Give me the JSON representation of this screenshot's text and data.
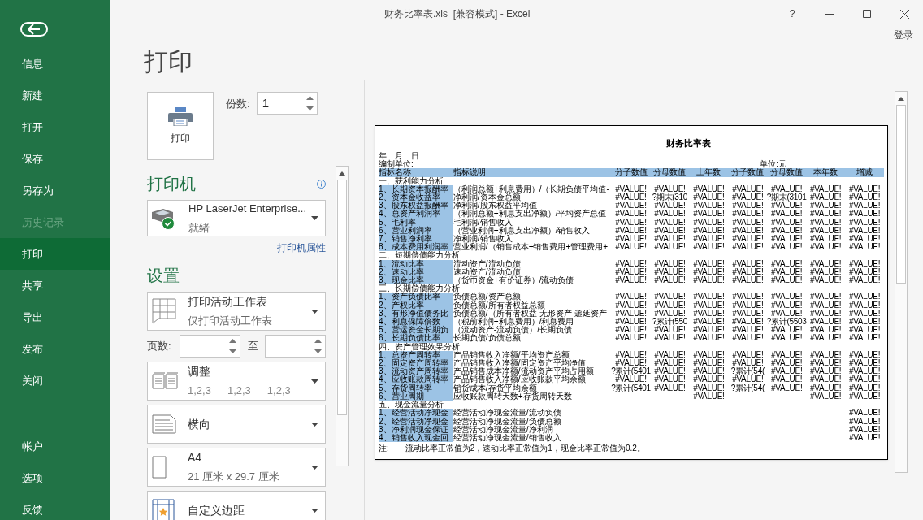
{
  "window": {
    "title": "财务比率表.xls  [兼容模式] - Excel",
    "help": "?",
    "sign_in": "登录"
  },
  "nav": {
    "items": [
      {
        "label": "信息",
        "selected": false,
        "disabled": false
      },
      {
        "label": "新建",
        "selected": false,
        "disabled": false
      },
      {
        "label": "打开",
        "selected": false,
        "disabled": false
      },
      {
        "label": "保存",
        "selected": false,
        "disabled": false
      },
      {
        "label": "另存为",
        "selected": false,
        "disabled": false
      },
      {
        "label": "历史记录",
        "selected": false,
        "disabled": true
      },
      {
        "label": "打印",
        "selected": true,
        "disabled": false
      },
      {
        "label": "共享",
        "selected": false,
        "disabled": false
      },
      {
        "label": "导出",
        "selected": false,
        "disabled": false
      },
      {
        "label": "发布",
        "selected": false,
        "disabled": false
      },
      {
        "label": "关闭",
        "selected": false,
        "disabled": false
      }
    ],
    "footer_items": [
      {
        "label": "帐户",
        "selected": false,
        "disabled": false
      },
      {
        "label": "选项",
        "selected": false,
        "disabled": false
      },
      {
        "label": "反馈",
        "selected": false,
        "disabled": false
      }
    ]
  },
  "page_title": "打印",
  "print_button": {
    "label": "打印"
  },
  "copies": {
    "label": "份数:",
    "value": "1"
  },
  "printer": {
    "heading": "打印机",
    "name": "HP LaserJet Enterprise...",
    "status": "就绪",
    "properties_link": "打印机属性"
  },
  "settings": {
    "heading": "设置",
    "options": [
      {
        "kind": "sheets",
        "title": "打印活动工作表",
        "subtitle": "仅打印活动工作表"
      },
      {
        "kind": "pages",
        "label": "页数:",
        "to": "至"
      },
      {
        "kind": "collate",
        "title": "调整",
        "sequences": [
          "1,2,3",
          "1,2,3",
          "1,2,3"
        ]
      },
      {
        "kind": "orientation",
        "title": "横向"
      },
      {
        "kind": "paper",
        "title": "A4",
        "subtitle": "21 厘米 x 29.7 厘米"
      },
      {
        "kind": "margins",
        "title": "自定义边距"
      }
    ]
  },
  "preview": {
    "title": "财务比率表",
    "date": "年　月　日",
    "unit_label": "编制单位:",
    "unit": "单位:元",
    "columns": [
      "指标名称",
      "指标说明",
      "分子数值",
      "分母数值",
      "上年数",
      "分子数值",
      "分母数值",
      "本年数",
      "增减"
    ],
    "sections": [
      {
        "heading": "一、获利能力分析",
        "rows": [
          {
            "name": "1、长期资本报酬率",
            "formula": "（利润总额+利息费用）/（长期负债平均值-",
            "values": {
              "column_3": "#VALUE!",
              "column_4": "#VALUE!",
              "column_5": "#VALUE!",
              "column_6": "#VALUE!",
              "column_7": "#VALUE!",
              "column_8": "#VALUE!",
              "column_9": "#VALUE!"
            }
          },
          {
            "name": "2、资本金收益率",
            "formula": "净利润/资本金总额",
            "values": {
              "column_3": "#VALUE!",
              "column_4": "?期末(310",
              "column_5": "#VALUE!",
              "column_6": "#VALUE!",
              "column_7": "?期末(3101",
              "column_8": "#VALUE!",
              "column_9": "#VALUE!"
            }
          },
          {
            "name": "3、股东权益报酬率",
            "formula": "净利润/股东权益平均值",
            "values": {
              "column_3": "#VALUE!",
              "column_4": "#VALUE!",
              "column_5": "#VALUE!",
              "column_6": "#VALUE!",
              "column_7": "#VALUE!",
              "column_8": "#VALUE!",
              "column_9": "#VALUE!"
            }
          },
          {
            "name": "4、总资产利润率",
            "formula": "（利润总额+利息支出净额）/平均资产总值",
            "values": {
              "column_3": "#VALUE!",
              "column_4": "#VALUE!",
              "column_5": "#VALUE!",
              "column_6": "#VALUE!",
              "column_7": "#VALUE!",
              "column_8": "#VALUE!",
              "column_9": "#VALUE!"
            }
          },
          {
            "name": "5、毛利率",
            "formula": "毛利润/销售收入",
            "values": {
              "column_3": "#VALUE!",
              "column_4": "#VALUE!",
              "column_5": "#VALUE!",
              "column_6": "#VALUE!",
              "column_7": "#VALUE!",
              "column_8": "#VALUE!",
              "column_9": "#VALUE!"
            }
          },
          {
            "name": "6、营业利润率",
            "formula": "（营业利润+利息支出净额）/销售收入",
            "values": {
              "column_3": "#VALUE!",
              "column_4": "#VALUE!",
              "column_5": "#VALUE!",
              "column_6": "#VALUE!",
              "column_7": "#VALUE!",
              "column_8": "#VALUE!",
              "column_9": "#VALUE!"
            }
          },
          {
            "name": "7、销售净利率",
            "formula": "净利润/销售收入",
            "values": {
              "column_3": "#VALUE!",
              "column_4": "#VALUE!",
              "column_5": "#VALUE!",
              "column_6": "#VALUE!",
              "column_7": "#VALUE!",
              "column_8": "#VALUE!",
              "column_9": "#VALUE!"
            }
          },
          {
            "name": "8、成本费用利润率",
            "formula": "营业利润/（销售成本+销售费用+管理费用+",
            "values": {
              "column_3": "#VALUE!",
              "column_4": "#VALUE!",
              "column_5": "#VALUE!",
              "column_6": "#VALUE!",
              "column_7": "#VALUE!",
              "column_8": "#VALUE!",
              "column_9": "#VALUE!"
            }
          }
        ]
      },
      {
        "heading": "二、短期偿债能力分析",
        "rows": [
          {
            "name": "1、流动比率",
            "formula": "流动资产/流动负债",
            "values": {
              "column_3": "#VALUE!",
              "column_4": "#VALUE!",
              "column_5": "#VALUE!",
              "column_6": "#VALUE!",
              "column_7": "#VALUE!",
              "column_8": "#VALUE!",
              "column_9": "#VALUE!"
            }
          },
          {
            "name": "2、速动比率",
            "formula": "速动资产/流动负债",
            "values": {
              "column_3": "#VALUE!",
              "column_4": "#VALUE!",
              "column_5": "#VALUE!",
              "column_6": "#VALUE!",
              "column_7": "#VALUE!",
              "column_8": "#VALUE!",
              "column_9": "#VALUE!"
            }
          },
          {
            "name": "3、现金比率",
            "formula": "（货币资金+有价证券）/流动负债",
            "values": {
              "column_3": "#VALUE!",
              "column_4": "#VALUE!",
              "column_5": "#VALUE!",
              "column_6": "#VALUE!",
              "column_7": "#VALUE!",
              "column_8": "#VALUE!",
              "column_9": "#VALUE!"
            }
          }
        ]
      },
      {
        "heading": "三、长期偿债能力分析",
        "rows": [
          {
            "name": "1、资产负债比率",
            "formula": "负债总额/资产总额",
            "values": {
              "column_3": "#VALUE!",
              "column_4": "#VALUE!",
              "column_5": "#VALUE!",
              "column_6": "#VALUE!",
              "column_7": "#VALUE!",
              "column_8": "#VALUE!",
              "column_9": "#VALUE!"
            }
          },
          {
            "name": "2、产权比率",
            "formula": "负债总额/所有者权益总额",
            "values": {
              "column_3": "#VALUE!",
              "column_4": "#VALUE!",
              "column_5": "#VALUE!",
              "column_6": "#VALUE!",
              "column_7": "#VALUE!",
              "column_8": "#VALUE!",
              "column_9": "#VALUE!"
            }
          },
          {
            "name": "3、有形净值债务比",
            "formula": "负债总额/（所有者权益-无形资产-递延资产",
            "values": {
              "column_3": "#VALUE!",
              "column_4": "#VALUE!",
              "column_5": "#VALUE!",
              "column_6": "#VALUE!",
              "column_7": "#VALUE!",
              "column_8": "#VALUE!",
              "column_9": "#VALUE!"
            }
          },
          {
            "name": "4、利息保障倍数",
            "formula": "（税前利润+利息费用）/利息费用",
            "values": {
              "column_3": "#VALUE!",
              "column_4": "?累计(550",
              "column_5": "#VALUE!",
              "column_6": "#VALUE!",
              "column_7": "?累计(5503",
              "column_8": "#VALUE!",
              "column_9": "#VALUE!"
            }
          },
          {
            "name": "5、营运资金长期负",
            "formula": "（流动资产-流动负债）/长期负债",
            "values": {
              "column_3": "#VALUE!",
              "column_4": "#VALUE!",
              "column_5": "#VALUE!",
              "column_6": "#VALUE!",
              "column_7": "#VALUE!",
              "column_8": "#VALUE!",
              "column_9": "#VALUE!"
            }
          },
          {
            "name": "6、长期负债比率",
            "formula": "长期负债/负债总额",
            "values": {
              "column_3": "#VALUE!",
              "column_4": "#VALUE!",
              "column_5": "#VALUE!",
              "column_6": "#VALUE!",
              "column_7": "#VALUE!",
              "column_8": "#VALUE!",
              "column_9": "#VALUE!"
            }
          }
        ]
      },
      {
        "heading": "四、资产管理效果分析",
        "rows": [
          {
            "name": "1、总资产周转率",
            "formula": "产品销售收入净额/平均资产总额",
            "values": {
              "column_3": "#VALUE!",
              "column_4": "#VALUE!",
              "column_5": "#VALUE!",
              "column_6": "#VALUE!",
              "column_7": "#VALUE!",
              "column_8": "#VALUE!",
              "column_9": "#VALUE!"
            }
          },
          {
            "name": "2、固定资产周转率",
            "formula": "产品销售收入净额/固定资产平均净值",
            "values": {
              "column_3": "#VALUE!",
              "column_4": "#VALUE!",
              "column_5": "#VALUE!",
              "column_6": "#VALUE!",
              "column_7": "#VALUE!",
              "column_8": "#VALUE!",
              "column_9": "#VALUE!"
            }
          },
          {
            "name": "3、流动资产周转率",
            "formula": "产品销售成本净额/流动资产平均占用额",
            "values": {
              "column_3": "?累计(5401",
              "column_4": "#VALUE!",
              "column_5": "#VALUE!",
              "column_6": "?累计(54(",
              "column_7": "#VALUE!",
              "column_8": "#VALUE!",
              "column_9": "#VALUE!"
            }
          },
          {
            "name": "4、应收账款周转率",
            "formula": "产品销售收入净额/应收账款平均余额",
            "values": {
              "column_3": "#VALUE!",
              "column_4": "#VALUE!",
              "column_5": "#VALUE!",
              "column_6": "#VALUE!",
              "column_7": "#VALUE!",
              "column_8": "#VALUE!",
              "column_9": "#VALUE!"
            }
          },
          {
            "name": "5、存货周转率",
            "formula": "销货成本/存货平均余额",
            "values": {
              "column_3": "?累计(5401",
              "column_4": "#VALUE!",
              "column_5": "#VALUE!",
              "column_6": "?累计(54(",
              "column_7": "#VALUE!",
              "column_8": "#VALUE!",
              "column_9": "#VALUE!"
            }
          },
          {
            "name": "6、营业周期",
            "formula": "应收账款周转天数+存货周转天数",
            "values": {
              "column_5": "#VALUE!",
              "column_8": "#VALUE!",
              "column_9": "#VALUE!"
            }
          }
        ]
      },
      {
        "heading": "五、现金流量分析",
        "rows": [
          {
            "name": "1、经营活动净现金",
            "formula": "经营活动净现金流量/流动负债",
            "values": {
              "column_9": "#VALUE!"
            }
          },
          {
            "name": "2、经营活动净现金",
            "formula": "经营活动净现金流量/负债总额",
            "values": {
              "column_9": "#VALUE!"
            }
          },
          {
            "name": "3、净利润现金保证",
            "formula": "经营活动净现金流量/净利润",
            "values": {
              "column_9": "#VALUE!"
            }
          },
          {
            "name": "4、销售收入现金回",
            "formula": "经营活动净现金流量/销售收入",
            "values": {
              "column_9": "#VALUE!"
            }
          }
        ]
      }
    ],
    "note": "注:　　流动比率正常值为2，速动比率正常值为1，现金比率正常值为0.2。"
  }
}
